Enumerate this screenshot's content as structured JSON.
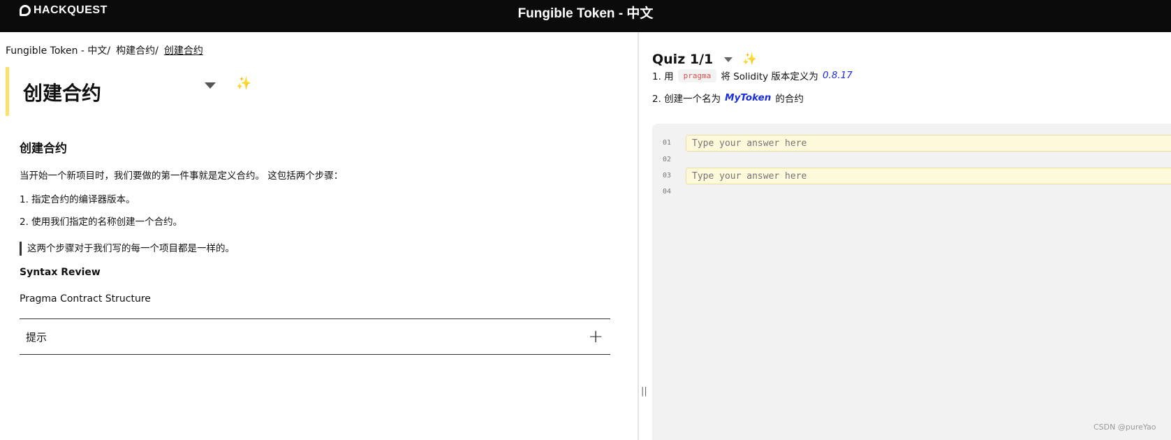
{
  "header": {
    "logo_text": "HACKQUEST",
    "title": "Fungible Token - 中文"
  },
  "breadcrumb": [
    "Fungible Token - 中文/",
    "构建合约/",
    "创建合约"
  ],
  "lesson": {
    "title": "创建合约",
    "section_heading": "创建合约",
    "intro": "当开始一个新项目时，我们要做的第一件事就是定义合约。 这包括两个步骤：",
    "steps": [
      "1.  指定合约的编译器版本。",
      "2.  使用我们指定的名称创建一个合约。"
    ],
    "quote": "这两个步骤对于我们写的每一个项目都是一样的。",
    "syntax_review": "Syntax Review",
    "syntax_item": "Pragma Contract Structure",
    "hint_label": "提示"
  },
  "quiz": {
    "title": "Quiz 1/1",
    "task1": {
      "prefix": "1.  用",
      "chip": "pragma",
      "middle": "将 Solidity 版本定义为",
      "value": "0.8.17"
    },
    "task2": {
      "prefix": "2.  创建一个名为",
      "value": "MyToken",
      "suffix": "的合约"
    },
    "editor": {
      "line_numbers": [
        "01",
        "02",
        "03",
        "04"
      ],
      "placeholder": "Type your answer here"
    }
  },
  "watermark": "CSDN @pureYao",
  "colors": {
    "header_bg": "#0b0b0b",
    "title_accent": "#fbe36b",
    "link_blue": "#1a2de0",
    "chip_red": "#d9534f",
    "input_bg": "#fff9dc"
  }
}
